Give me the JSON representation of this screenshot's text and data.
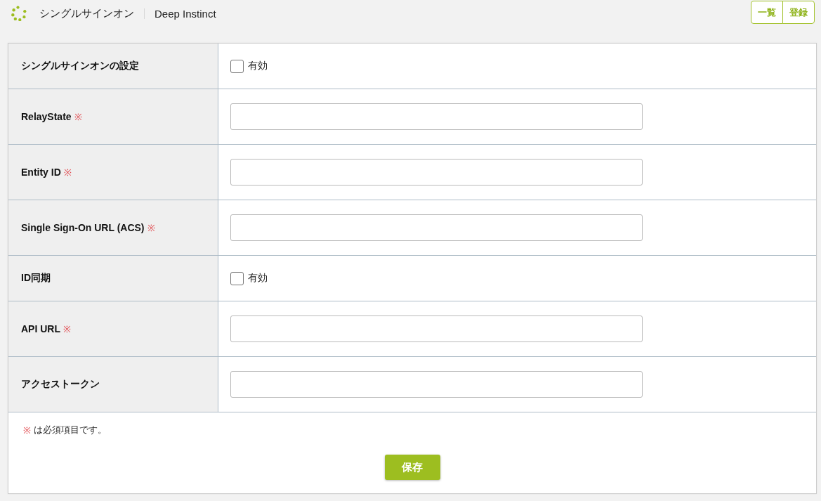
{
  "header": {
    "title": "シングルサインオン",
    "subtitle": "Deep Instinct",
    "buttons": [
      "一覧",
      "登録"
    ]
  },
  "form": {
    "rows": [
      {
        "kind": "checkbox",
        "label": "シングルサインオンの設定",
        "option": "有効",
        "checked": false
      },
      {
        "kind": "text",
        "label": "RelayState",
        "required_mark": "※"
      },
      {
        "kind": "text",
        "label": "Entity ID",
        "required_mark": "※"
      },
      {
        "kind": "text",
        "label": "Single Sign-On URL (ACS)",
        "required_mark": "※"
      },
      {
        "kind": "checkbox",
        "label": "ID同期",
        "option": "有効",
        "checked": false
      },
      {
        "kind": "text",
        "label": "API URL",
        "required_mark": "※"
      },
      {
        "kind": "text",
        "label": "アクセストークン"
      }
    ]
  },
  "footer": {
    "note_mark": "※",
    "note": "は必須項目です。",
    "save_button": "保存"
  }
}
